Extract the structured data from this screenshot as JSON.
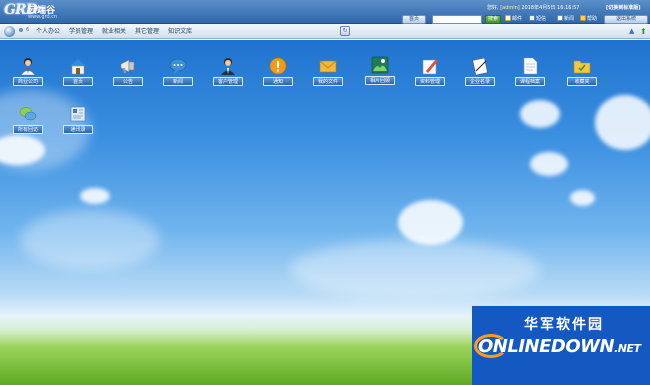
{
  "header": {
    "logo_mark": "GRD",
    "logo_name": "云端谷",
    "logo_url": "www.grd.cn",
    "welcome_prefix": "您好,",
    "username": "[admin]",
    "date_text": "2018年4月5日 16:16:57",
    "switch_label": "[切换到标准版]",
    "home_label": "首页",
    "search_value": "",
    "search_button": "搜索",
    "mail_label": "邮件",
    "sms_label": "短信",
    "news_label": "新闻",
    "help_label": "帮助",
    "logout_label": "退出系统"
  },
  "nav": {
    "small_text": "6",
    "items": [
      "个人办公",
      "学员管理",
      "就业相关",
      "其它管理",
      "知识文库"
    ]
  },
  "desktop_icons": [
    {
      "label": "商业公司",
      "icon": "person-icon"
    },
    {
      "label": "首页",
      "icon": "home-icon"
    },
    {
      "label": "公告",
      "icon": "megaphone-icon"
    },
    {
      "label": "新闻",
      "icon": "chat-bubble-icon"
    },
    {
      "label": "客户管理",
      "icon": "user-icon"
    },
    {
      "label": "通知",
      "icon": "alert-icon"
    },
    {
      "label": "我的文件",
      "icon": "envelope-icon"
    },
    {
      "label": "相片回顾",
      "icon": "photo-icon"
    },
    {
      "label": "资料管理",
      "icon": "edit-icon"
    },
    {
      "label": "企业名录",
      "icon": "notebook-icon"
    },
    {
      "label": "课程档案",
      "icon": "document-icon"
    },
    {
      "label": "收藏夹",
      "icon": "folder-icon"
    },
    {
      "label": "所有回访",
      "icon": "speech-bubbles-icon"
    },
    {
      "label": "通讯录",
      "icon": "address-book-icon"
    }
  ],
  "watermark": {
    "subtitle": "华军软件园",
    "brand": "ONLINEDOWN",
    "tld": ".NET"
  },
  "colors": {
    "header_blue": "#2f67aa",
    "label_blue": "#2c64a8",
    "sky": "#3a8fe0",
    "grass": "#5faa24",
    "watermark": "#1459c2",
    "swoosh": "#ff9c1a"
  }
}
